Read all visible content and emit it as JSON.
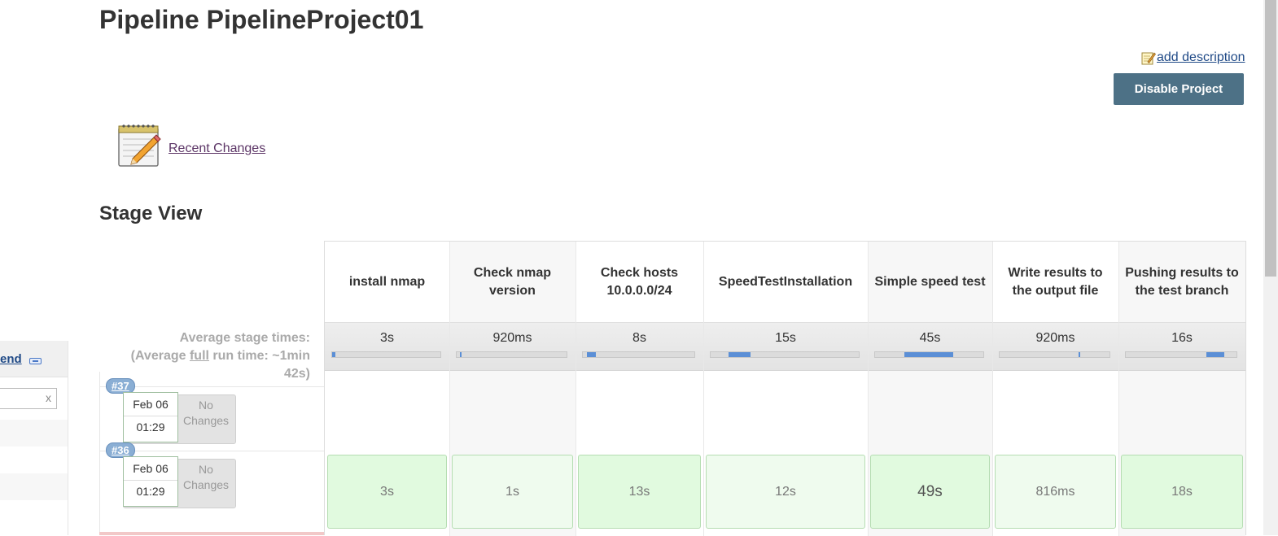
{
  "page": {
    "title": "Pipeline PipelineProject01"
  },
  "actions": {
    "add_description": "add description",
    "disable_project": "Disable Project"
  },
  "recent_changes": {
    "label": "Recent Changes"
  },
  "stage_view": {
    "title": "Stage View",
    "avg_label_line1": "Average stage times:",
    "avg_label_prefix": "(Average ",
    "avg_label_full": "full",
    "avg_label_suffix": " run time: ~1min",
    "avg_label_line3": "42s)",
    "stages": [
      {
        "name": "install nmap",
        "avg": "3s",
        "share": 0.03
      },
      {
        "name": "Check nmap version",
        "avg": "920ms",
        "share": 0.01
      },
      {
        "name": "Check hosts 10.0.0.0/24",
        "avg": "8s",
        "share": 0.08
      },
      {
        "name": "SpeedTestInstallation",
        "avg": "15s",
        "share": 0.15
      },
      {
        "name": "Simple speed test",
        "avg": "45s",
        "share": 0.45
      },
      {
        "name": "Write results to the output file",
        "avg": "920ms",
        "share": 0.01
      },
      {
        "name": "Pushing results to the test branch",
        "avg": "16s",
        "share": 0.16
      }
    ],
    "runs": [
      {
        "id": "#37",
        "date": "Feb 06",
        "time": "01:29",
        "changes": "No Changes",
        "cells": [
          "",
          "",
          "",
          "",
          "",
          "",
          ""
        ]
      },
      {
        "id": "#36",
        "date": "Feb 06",
        "time": "01:29",
        "changes": "No Changes",
        "cells": [
          "3s",
          "1s",
          "13s",
          "12s",
          "49s",
          "816ms",
          "18s"
        ]
      }
    ]
  },
  "sidebar": {
    "trend_label": "end",
    "filter_clear": "x"
  },
  "colors": {
    "button_bg": "#4d7186",
    "success_cell": "#e1fadf",
    "link": "#204a87",
    "badge": "#8aaed4"
  }
}
